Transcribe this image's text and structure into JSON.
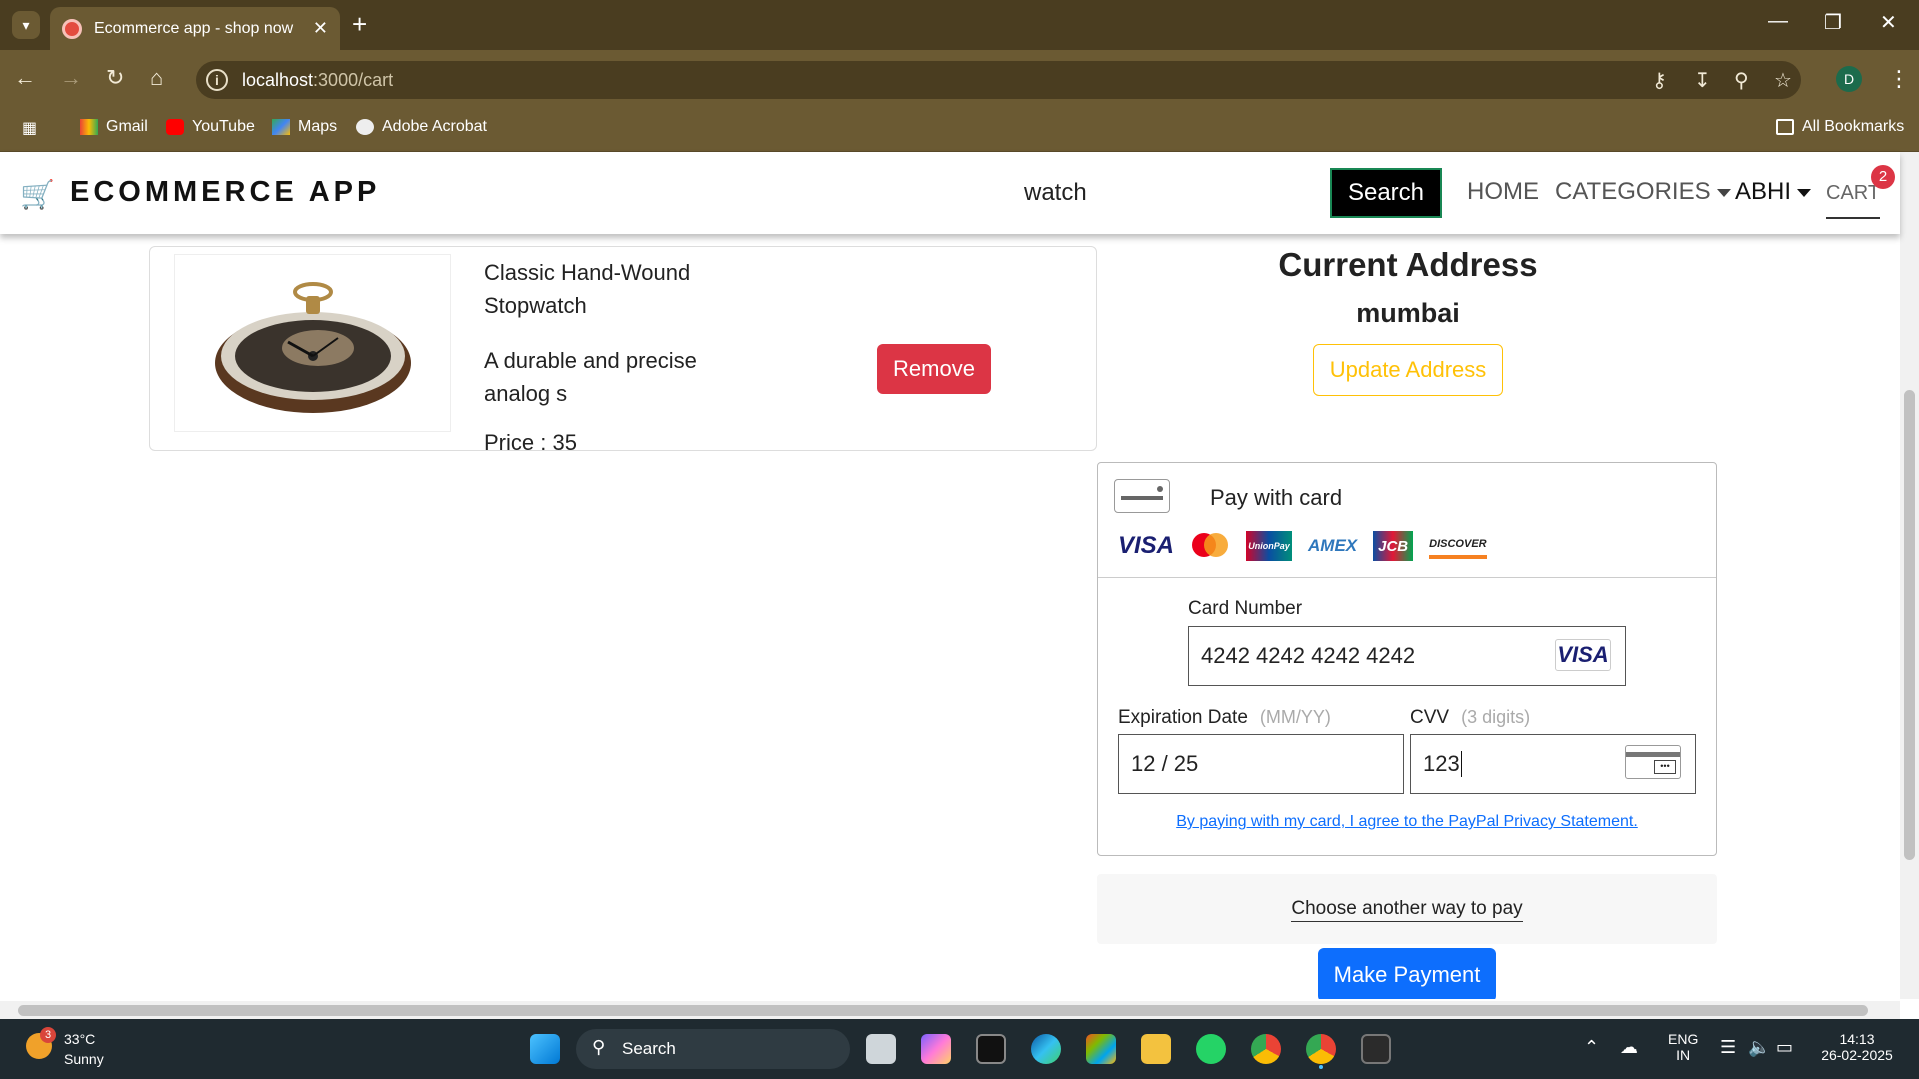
{
  "browser": {
    "tab_title": "Ecommerce app - shop now",
    "url_host": "localhost",
    "url_path": ":3000/cart",
    "profile_initial": "D",
    "bookmarks": [
      {
        "label": "Gmail",
        "icon": "gmail-icon"
      },
      {
        "label": "YouTube",
        "icon": "youtube-icon"
      },
      {
        "label": "Maps",
        "icon": "maps-icon"
      },
      {
        "label": "Adobe Acrobat",
        "icon": "acrobat-icon"
      }
    ],
    "all_bookmarks": "All Bookmarks"
  },
  "header": {
    "brand": "ECOMMERCE APP",
    "search_value": "watch",
    "search_button": "Search",
    "nav": {
      "home": "HOME",
      "categories": "CATEGORIES",
      "user": "ABHI",
      "cart": "CART",
      "cart_count": "2"
    }
  },
  "cart_item": {
    "name": "Classic Hand-Wound Stopwatch",
    "description": "A durable and precise analog s",
    "price": "Price : 35",
    "remove_label": "Remove"
  },
  "address": {
    "title": "Current Address",
    "value": "mumbai",
    "update_label": "Update Address"
  },
  "payment": {
    "header": "Pay with card",
    "card_brands": [
      "VISA",
      "Mastercard",
      "UnionPay",
      "AMEX",
      "JCB",
      "DISCOVER"
    ],
    "card_number_label": "Card Number",
    "card_number_value": "4242 4242 4242 4242",
    "card_number_brand": "VISA",
    "expiry_label": "Expiration Date",
    "expiry_hint": "(MM/YY)",
    "expiry_value": "12 / 25",
    "cvv_label": "CVV",
    "cvv_hint": "(3 digits)",
    "cvv_value": "123",
    "privacy_text": "By paying with my card, I agree to the PayPal Privacy Statement.",
    "alt_pay": "Choose another way to pay",
    "make_payment": "Make Payment"
  },
  "taskbar": {
    "weather_badge": "3",
    "temperature": "33°C",
    "condition": "Sunny",
    "search": "Search",
    "lang_top": "ENG",
    "lang_bottom": "IN",
    "time": "14:13",
    "date": "26-02-2025"
  }
}
